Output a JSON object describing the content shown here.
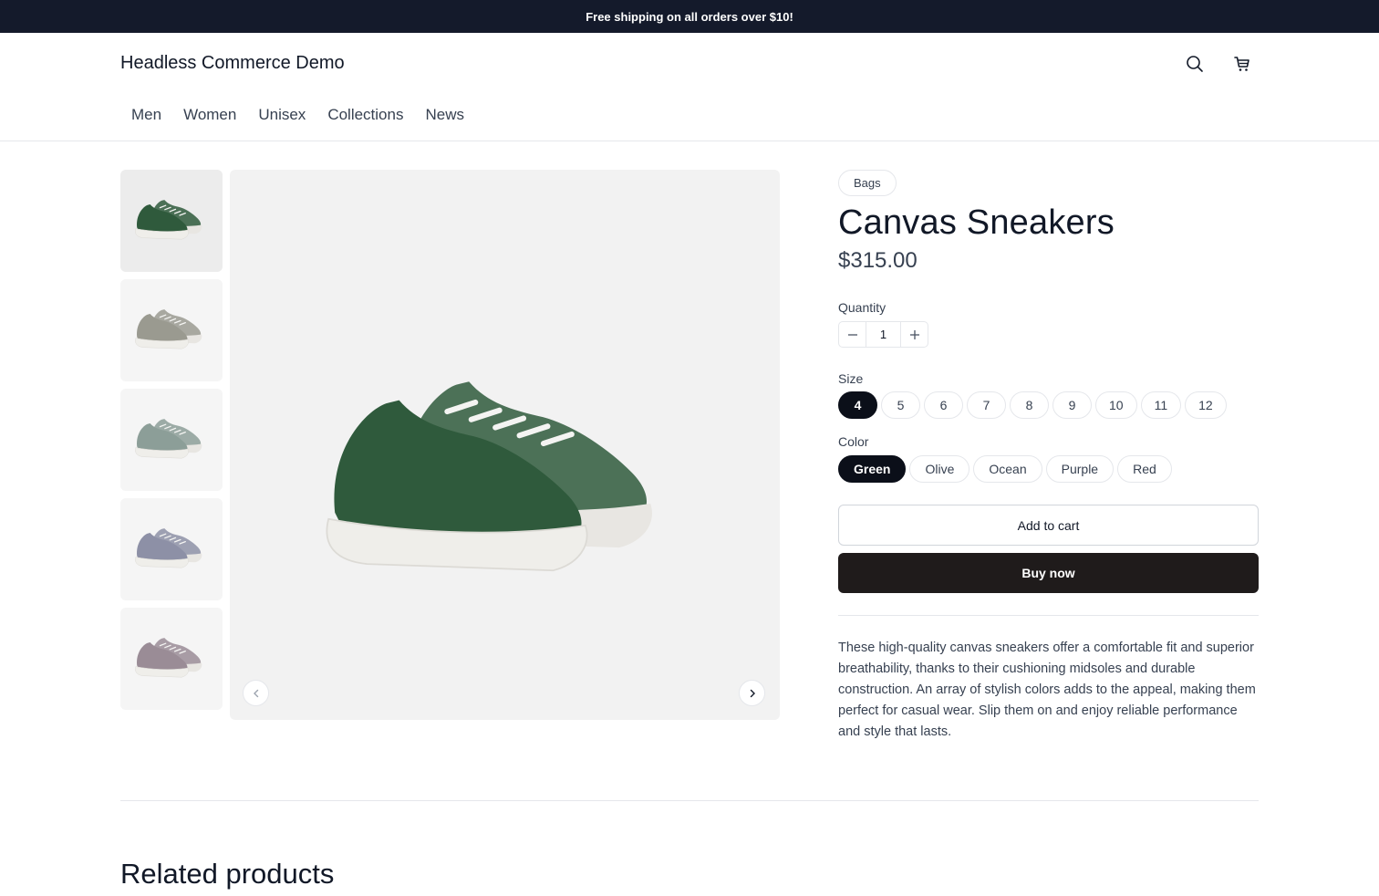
{
  "announcement": "Free shipping on all orders over $10!",
  "header": {
    "brand": "Headless Commerce Demo",
    "nav": [
      "Men",
      "Women",
      "Unisex",
      "Collections",
      "News"
    ]
  },
  "gallery": {
    "thumb_colors": [
      "#2f5a3c",
      "#9a9a90",
      "#8c9e98",
      "#8d90a6",
      "#9a8c96"
    ],
    "main_color": "#2f5a3c"
  },
  "product": {
    "category": "Bags",
    "title": "Canvas Sneakers",
    "price": "$315.00",
    "quantity_label": "Quantity",
    "quantity": "1",
    "size_label": "Size",
    "sizes": [
      "4",
      "5",
      "6",
      "7",
      "8",
      "9",
      "10",
      "11",
      "12"
    ],
    "selected_size": "4",
    "color_label": "Color",
    "colors": [
      "Green",
      "Olive",
      "Ocean",
      "Purple",
      "Red"
    ],
    "selected_color": "Green",
    "add_to_cart": "Add to cart",
    "buy_now": "Buy now",
    "description": "These high-quality canvas sneakers offer a comfortable fit and superior breathability, thanks to their cushioning midsoles and durable construction. An array of stylish colors adds to the appeal, making them perfect for casual wear. Slip them on and enjoy reliable performance and style that lasts."
  },
  "related_title": "Related products"
}
